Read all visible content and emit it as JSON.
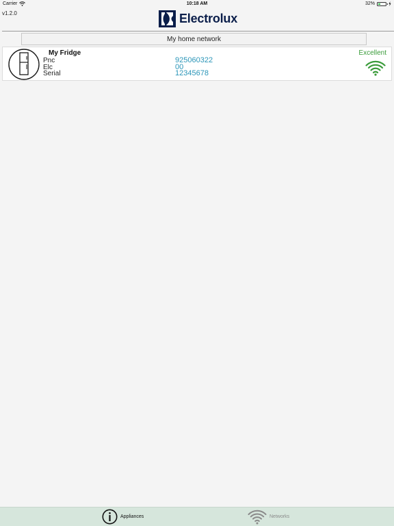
{
  "status_bar": {
    "carrier": "Carrier",
    "time": "10:18 AM",
    "battery_text": "32%",
    "battery_level": 0.32
  },
  "header": {
    "version": "v1.2.0",
    "brand": "Electrolux"
  },
  "network": {
    "name": "My home network"
  },
  "appliances": [
    {
      "name": "My Fridge",
      "fields": [
        {
          "label": "Pnc",
          "value": "925060322"
        },
        {
          "label": "Elc",
          "value": "00"
        },
        {
          "label": "Serial",
          "value": "12345678"
        }
      ],
      "signal": "Excellent"
    }
  ],
  "tabs": {
    "appliances": "Appliances",
    "networks": "Networks"
  },
  "colors": {
    "brand": "#0b1e4a",
    "signal_good": "#3a9b3a",
    "value_text": "#2a95b8",
    "tab_bar": "#d6e6dc",
    "background": "#f4f4f4"
  },
  "icons": {
    "appliance": "fridge-icon",
    "signal": "wifi-icon",
    "tab_appliances": "info-icon",
    "tab_networks": "wifi-icon"
  }
}
